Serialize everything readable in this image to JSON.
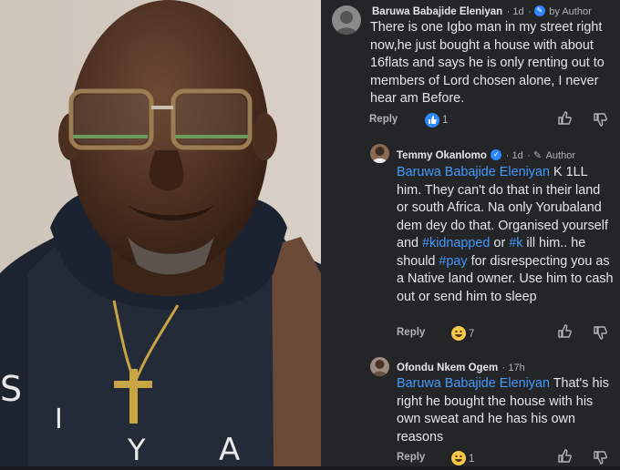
{
  "comments": [
    {
      "name": "Baruwa Babajide Eleniyan",
      "time": "1d",
      "author_label": "by Author",
      "text": "There is one Igbo man in my street right now,he just bought a house with about 16flats and says he is only renting out to members of Lord chosen alone, I never hear am Before.",
      "reply_label": "Reply",
      "reaction_count": "1",
      "reaction_icon": "like-icon"
    },
    {
      "name": "Temmy Okanlomo",
      "time": "1d",
      "author_label": "Author",
      "mention": "Baruwa Babajide Eleniyan",
      "text_parts": [
        "K 1LL him. They can't do that in their land or south Africa. Na only Yorubaland dem dey do that. Organised yourself and ",
        "#kidnapped",
        " or ",
        "#k",
        " ill him.. he should ",
        "#pay",
        " for disrespecting you as a Native land owner. Use him to cash out or send him to sleep"
      ],
      "reply_label": "Reply",
      "reaction_count": "7",
      "reaction_icon": "haha-icon"
    },
    {
      "name": "Ofondu Nkem Ogem",
      "time": "17h",
      "mention": "Baruwa Babajide Eleniyan",
      "text": " That's his right he bought the house with his own sweat and he has his own reasons",
      "reply_label": "Reply",
      "reaction_count": "1",
      "reaction_icon": "haha-icon"
    }
  ],
  "colors": {
    "link": "#4599ff",
    "author_badge": "#2d88ff",
    "panel_bg": "#242526"
  }
}
